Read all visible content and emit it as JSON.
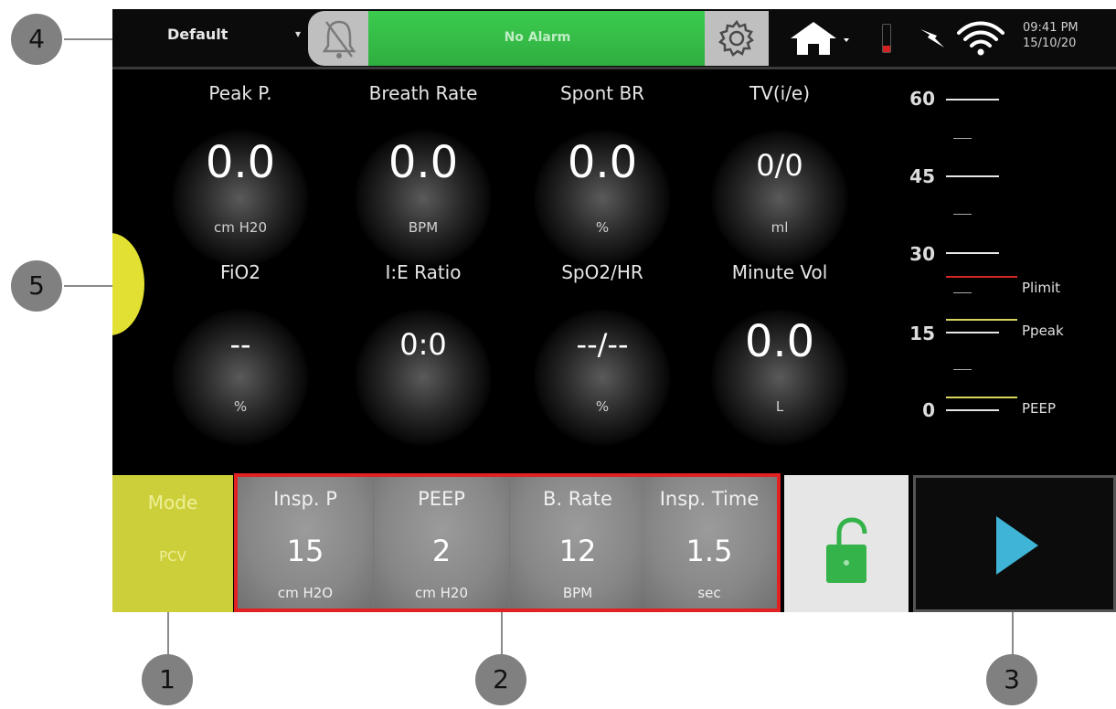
{
  "topbar": {
    "profile": "Default",
    "profile_caret": "▾",
    "alarm_status": "No Alarm",
    "clock_time": "09:41 PM",
    "clock_date": "15/10/20",
    "battery_level": 0.25,
    "alarm_color": "#35bd48"
  },
  "monitors": [
    {
      "label": "Peak P.",
      "value": "0.0",
      "unit": "cm H20"
    },
    {
      "label": "Breath Rate",
      "value": "0.0",
      "unit": "BPM"
    },
    {
      "label": "Spont BR",
      "value": "0.0",
      "unit": "%"
    },
    {
      "label": "TV(i/e)",
      "value": "0/0",
      "unit": "ml"
    },
    {
      "label": "FiO2",
      "value": "--",
      "unit": "%"
    },
    {
      "label": "I:E Ratio",
      "value": "0:0",
      "unit": ""
    },
    {
      "label": "SpO2/HR",
      "value": "--/--",
      "unit": "%"
    },
    {
      "label": "Minute Vol",
      "value": "0.0",
      "unit": "L"
    }
  ],
  "pressure_scale": {
    "ticks": [
      "60",
      "45",
      "30",
      "15",
      "0"
    ],
    "markers": [
      {
        "label": "Plimit",
        "color": "#d42828"
      },
      {
        "label": "Ppeak",
        "color": "#d8d460"
      },
      {
        "label": "PEEP",
        "color": "#d8d460"
      }
    ]
  },
  "mode": {
    "label": "Mode",
    "value": "PCV",
    "color": "#cdcf3a"
  },
  "settings": [
    {
      "label": "Insp. P",
      "value": "15",
      "unit": "cm H2O"
    },
    {
      "label": "PEEP",
      "value": "2",
      "unit": "cm H20"
    },
    {
      "label": "B. Rate",
      "value": "12",
      "unit": "BPM"
    },
    {
      "label": "Insp. Time",
      "value": "1.5",
      "unit": "sec"
    }
  ],
  "colors": {
    "highlight": "#e02222",
    "start": "#3fb4d6",
    "lock": "#34b34a"
  },
  "callouts": [
    "1",
    "2",
    "3",
    "4",
    "5"
  ]
}
